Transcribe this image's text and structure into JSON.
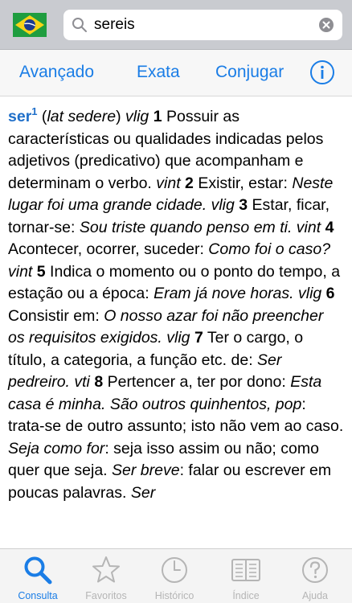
{
  "search": {
    "query": "sereis"
  },
  "toolbar": {
    "advanced": "Avançado",
    "exact": "Exata",
    "conjugate": "Conjugar"
  },
  "entry": {
    "headword": "ser",
    "superscript": "1",
    "p01": " (",
    "etym": "lat sedere",
    "p02": ") ",
    "cls1": "vlig",
    "p03": " ",
    "n1": "1",
    "d1": " Possuir as características ou qualidades indicadas pelos adjetivos (predicativo) que acompanham e determinam o verbo. ",
    "cls2": "vint",
    "p04": " ",
    "n2": "2",
    "d2": " Existir, estar: ",
    "ex2": "Neste lugar foi uma grande cidade. vlig",
    "p05": " ",
    "n3": "3",
    "d3": " Estar, ficar, tornar-se: ",
    "ex3": "Sou triste quando penso em ti. vint",
    "p06": " ",
    "n4": "4",
    "d4": " Acontecer, ocorrer, suceder: ",
    "ex4": "Como foi o caso? vint",
    "p07": " ",
    "n5": "5",
    "d5": " Indica o momento ou o ponto do tempo, a estação ou a época: ",
    "ex5": "Eram já nove horas. vlig",
    "p08": " ",
    "n6": "6",
    "d6": " Consistir em: ",
    "ex6": "O nosso azar foi não preencher os requisitos exigidos. vlig",
    "p09": " ",
    "n7": "7",
    "d7": " Ter o cargo, o título, a categoria, a função etc. de: ",
    "ex7": "Ser pedreiro. vti",
    "p10": " ",
    "n8": "8",
    "d8": " Pertencer a, ter por dono: ",
    "ex8": "Esta casa é minha. São outros quinhentos, pop",
    "d9": ": trata-se de outro assunto; isto não vem ao caso. ",
    "ex9": "Seja como for",
    "d10": ": seja isso assim ou não; como quer que seja. ",
    "ex10": "Ser breve",
    "d11": ": falar ou escrever em poucas palavras. ",
    "ex11": "Ser"
  },
  "tabs": [
    {
      "label": "Consulta",
      "icon": "search-icon"
    },
    {
      "label": "Favoritos",
      "icon": "star-icon"
    },
    {
      "label": "Histórico",
      "icon": "clock-icon"
    },
    {
      "label": "Índice",
      "icon": "book-icon"
    },
    {
      "label": "Ajuda",
      "icon": "help-icon"
    }
  ],
  "colors": {
    "accent": "#1a7de6",
    "headword": "#1f6fc9",
    "inactive_tab": "#b5b5b5"
  }
}
